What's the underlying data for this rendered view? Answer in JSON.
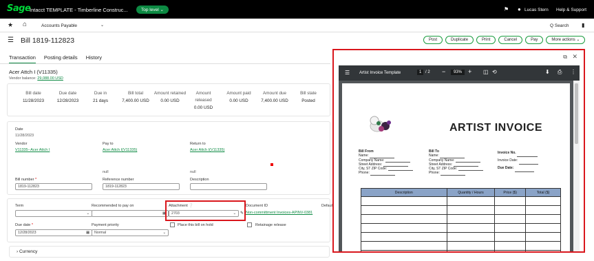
{
  "topbar": {
    "logo": "Sage",
    "app_title": "Intacct  TEMPLATE - Timberline Construc...",
    "top_level": "Top level ⌄",
    "user_name": "Lucas Stern",
    "help_label": "Help & Support"
  },
  "nav": {
    "module": "Accounts Payable",
    "search": "Q Search"
  },
  "page": {
    "title": "Bill 1819-112823"
  },
  "actions": [
    "Post",
    "Duplicate",
    "Print",
    "Cancel",
    "Pay",
    "More actions ⌄"
  ],
  "tabs": [
    {
      "label": "Transaction",
      "active": true
    },
    {
      "label": "Posting details",
      "active": false
    },
    {
      "label": "History",
      "active": false
    }
  ],
  "vendor": {
    "name": "Acer Attch I (V11335)",
    "balance_label": "Vendor balance:",
    "balance_value": "29,088.00 USD"
  },
  "summary": [
    {
      "label": "Bill date",
      "value": "11/28/2023"
    },
    {
      "label": "Due date",
      "value": "12/28/2023"
    },
    {
      "label": "Due in",
      "value": "21 days"
    },
    {
      "label": "Bill total",
      "value": "7,400.00 USD"
    },
    {
      "label": "Amount retained",
      "value": "0.00 USD"
    },
    {
      "label": "Amount released",
      "value": "0.00 USD"
    },
    {
      "label": "Amount paid",
      "value": "0.00 USD"
    },
    {
      "label": "Amount due",
      "value": "7,400.00 USD"
    },
    {
      "label": "Bill state",
      "value": "Posted"
    }
  ],
  "details": {
    "date_label": "Date",
    "date_value": "11/28/2023",
    "vendor_label": "Vendor",
    "vendor_value": "V11335--Acer Attch I",
    "payto_label": "Pay to",
    "payto_value": "Acer Attch I(V11335)",
    "returnto_label": "Return to",
    "returnto_value": "Acer Attch I(V11335)",
    "null1": "null",
    "null2": "null",
    "billnum_label": "Bill number",
    "billnum_value": "1819-112823",
    "refnum_label": "Reference number",
    "refnum_value": "1819-112823",
    "desc_label": "Description",
    "desc_value": ""
  },
  "terms": {
    "term_label": "Term",
    "term_value": "",
    "recpay_label": "Recommended to pay on",
    "recpay_value": "",
    "attachment_label": "Attachment",
    "attachment_value": "2703",
    "docid_label": "Document ID",
    "docid_value": "Non-committment Invoices-APINV-0381",
    "default_label": "Default",
    "duedate_label": "Due date",
    "duedate_value": "12/28/2023",
    "payprio_label": "Payment priority",
    "payprio_value": "Normal",
    "hold_label": "Place this bill on hold",
    "retainage_label": "Retainage release"
  },
  "currency_label": "Currency",
  "pdf": {
    "title": "Artist Invoice Template",
    "page": "1",
    "pages": "/ 2",
    "zoom": "93%",
    "heading": "ARTIST INVOICE",
    "bill_from": {
      "heading": "Bill From",
      "lines": [
        "Name:",
        "Company Name:",
        "Street Address:",
        "City, ST ZIP Code:",
        "Phone:"
      ]
    },
    "bill_to": {
      "heading": "Bill To",
      "lines": [
        "Name:",
        "Company Name:",
        "Street Address:",
        "City, ST ZIP Code:",
        "Phone:"
      ]
    },
    "invoice_fields": [
      "Invoice No.",
      "Invoice Date:",
      "Due Date:"
    ],
    "table_headers": [
      "Description",
      "Quantity / Hours",
      "Price ($)",
      "Total ($)"
    ]
  }
}
